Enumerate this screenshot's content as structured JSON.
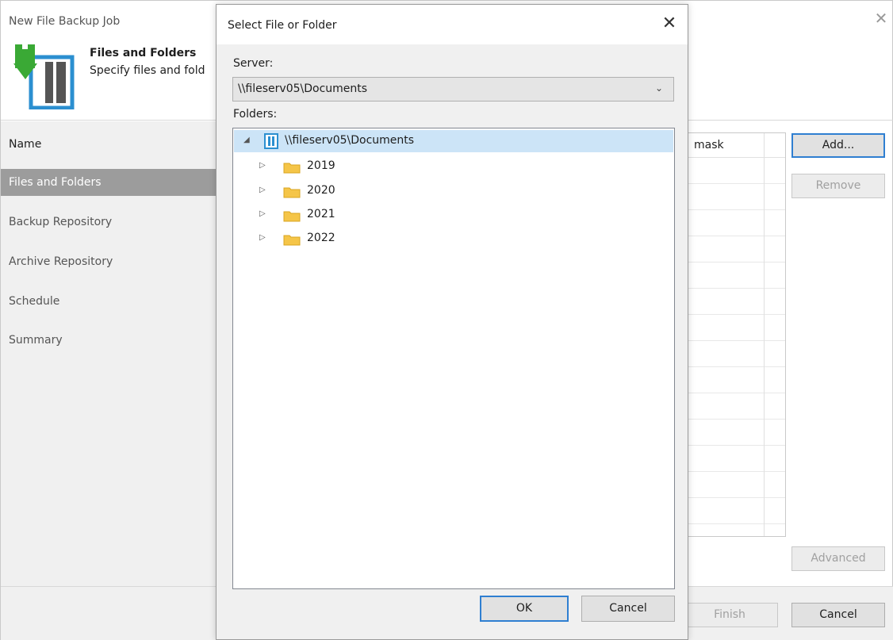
{
  "wizard": {
    "title": "New File Backup Job",
    "heading": "Files and Folders",
    "subheading": "Specify files and fold",
    "nav": [
      {
        "label": "Name"
      },
      {
        "label": "Files and Folders"
      },
      {
        "label": "Backup Repository"
      },
      {
        "label": "Archive Repository"
      },
      {
        "label": "Schedule"
      },
      {
        "label": "Summary"
      }
    ],
    "grid_column": "mask",
    "buttons": {
      "add": "Add...",
      "remove": "Remove",
      "advanced": "Advanced",
      "finish": "Finish",
      "cancel": "Cancel"
    }
  },
  "dialog": {
    "title": "Select File or Folder",
    "server_label": "Server:",
    "server_value": "\\\\fileserv05\\Documents",
    "folders_label": "Folders:",
    "tree": {
      "root": "\\\\fileserv05\\Documents",
      "children": [
        {
          "label": "2019"
        },
        {
          "label": "2020"
        },
        {
          "label": "2021"
        },
        {
          "label": "2022"
        }
      ]
    },
    "ok": "OK",
    "cancel": "Cancel"
  },
  "colors": {
    "selection": "#cce4f7",
    "nav_active": "#9c9c9c",
    "focus_border": "#2f7fd1",
    "folder": "#f5c548",
    "icon_green": "#3aa935",
    "icon_blue": "#2b8fd0"
  }
}
